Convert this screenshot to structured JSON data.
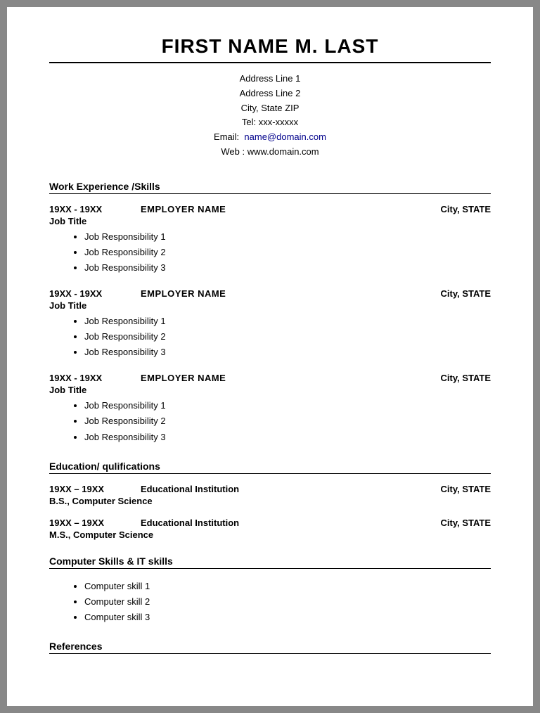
{
  "header": {
    "name": "FIRST NAME M. LAST",
    "address_line1": "Address Line 1",
    "address_line2": "Address Line 2",
    "city_state_zip": "City, State ZIP",
    "tel_label": "Tel:",
    "tel_value": "xxx-xxxxx",
    "email_label": "Email:",
    "email_value": "name@domain.com",
    "web_label": "Web :",
    "web_value": "www.domain.com"
  },
  "sections": {
    "work_experience": {
      "title": "Work Experience /Skills",
      "jobs": [
        {
          "dates": "19XX - 19XX",
          "employer": "EMPLOYER NAME",
          "location": "City, STATE",
          "title": "Job Title",
          "responsibilities": [
            "Job Responsibility 1",
            "Job Responsibility 2",
            "Job Responsibility 3"
          ]
        },
        {
          "dates": "19XX - 19XX",
          "employer": "EMPLOYER NAME",
          "location": "City, STATE",
          "title": "Job Title",
          "responsibilities": [
            "Job Responsibility 1",
            "Job Responsibility 2",
            "Job Responsibility 3"
          ]
        },
        {
          "dates": "19XX - 19XX",
          "employer": "EMPLOYER NAME",
          "location": "City, STATE",
          "title": "Job Title",
          "responsibilities": [
            "Job Responsibility 1",
            "Job Responsibility 2",
            "Job Responsibility 3"
          ]
        }
      ]
    },
    "education": {
      "title": "Education/ qulifications",
      "entries": [
        {
          "dates": "19XX – 19XX",
          "institution": "Educational Institution",
          "location": "City, STATE",
          "degree": "B.S., Computer Science"
        },
        {
          "dates": "19XX – 19XX",
          "institution": "Educational Institution",
          "location": "City, STATE",
          "degree": "M.S., Computer Science"
        }
      ]
    },
    "computer_skills": {
      "title": "Computer Skills & IT skills",
      "skills": [
        "Computer skill 1",
        "Computer skill 2",
        "Computer skill 3"
      ]
    },
    "references": {
      "title": "References"
    }
  }
}
